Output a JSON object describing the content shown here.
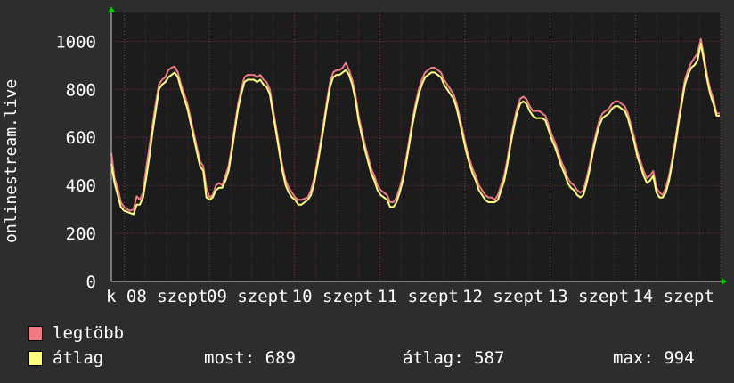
{
  "chart_data": {
    "type": "line",
    "ylabel": "onlinestream.live",
    "y_ticks": [
      0,
      200,
      400,
      600,
      800,
      1000
    ],
    "ylim": [
      0,
      1120
    ],
    "x_tick_labels": [
      "k 08 szept",
      "09 szept",
      "10 szept",
      "11 szept",
      "12 szept",
      "13 szept",
      "14 szept"
    ],
    "grid": true,
    "series": [
      {
        "name": "legtöbb",
        "color": "#f07a84",
        "values": [
          535,
          430,
          390,
          330,
          310,
          300,
          295,
          300,
          355,
          340,
          370,
          470,
          560,
          650,
          740,
          820,
          840,
          850,
          880,
          890,
          895,
          870,
          820,
          780,
          740,
          680,
          620,
          560,
          500,
          480,
          390,
          350,
          360,
          400,
          410,
          400,
          440,
          480,
          560,
          650,
          740,
          800,
          850,
          860,
          860,
          860,
          850,
          860,
          840,
          830,
          800,
          720,
          640,
          560,
          480,
          420,
          390,
          370,
          350,
          340,
          340,
          345,
          350,
          380,
          430,
          500,
          580,
          660,
          750,
          830,
          870,
          880,
          880,
          890,
          910,
          880,
          840,
          780,
          690,
          630,
          570,
          520,
          470,
          440,
          400,
          380,
          370,
          360,
          330,
          330,
          350,
          390,
          440,
          510,
          590,
          670,
          740,
          800,
          840,
          870,
          880,
          890,
          890,
          880,
          870,
          840,
          820,
          800,
          780,
          740,
          680,
          620,
          560,
          510,
          470,
          440,
          400,
          380,
          360,
          350,
          350,
          340,
          360,
          400,
          440,
          510,
          590,
          660,
          720,
          760,
          770,
          760,
          730,
          710,
          710,
          710,
          700,
          690,
          650,
          610,
          580,
          540,
          500,
          470,
          430,
          410,
          400,
          380,
          370,
          380,
          430,
          490,
          560,
          620,
          670,
          700,
          710,
          720,
          740,
          750,
          750,
          740,
          730,
          700,
          650,
          600,
          540,
          500,
          460,
          430,
          440,
          460,
          390,
          370,
          360,
          390,
          440,
          510,
          590,
          680,
          760,
          840,
          880,
          910,
          930,
          950,
          1010,
          940,
          860,
          800,
          760,
          700,
          700
        ]
      },
      {
        "name": "átlag",
        "color": "#ffff80",
        "values": [
          490,
          410,
          360,
          310,
          295,
          290,
          285,
          280,
          320,
          320,
          350,
          430,
          520,
          620,
          710,
          800,
          820,
          830,
          850,
          860,
          870,
          850,
          800,
          760,
          720,
          660,
          600,
          540,
          480,
          460,
          350,
          340,
          350,
          380,
          390,
          390,
          420,
          460,
          540,
          630,
          720,
          780,
          830,
          840,
          840,
          840,
          830,
          840,
          820,
          810,
          780,
          700,
          620,
          540,
          460,
          400,
          370,
          350,
          340,
          320,
          320,
          330,
          340,
          360,
          410,
          480,
          560,
          640,
          730,
          810,
          850,
          860,
          860,
          870,
          880,
          860,
          820,
          760,
          670,
          610,
          550,
          500,
          450,
          420,
          380,
          360,
          350,
          340,
          310,
          310,
          330,
          370,
          420,
          490,
          570,
          650,
          720,
          780,
          820,
          850,
          860,
          870,
          870,
          860,
          850,
          820,
          800,
          780,
          760,
          720,
          660,
          600,
          540,
          490,
          450,
          420,
          380,
          360,
          340,
          330,
          330,
          330,
          340,
          380,
          420,
          490,
          570,
          640,
          700,
          740,
          750,
          740,
          710,
          690,
          680,
          680,
          680,
          670,
          630,
          590,
          560,
          520,
          480,
          450,
          410,
          390,
          380,
          360,
          350,
          360,
          410,
          470,
          540,
          600,
          650,
          680,
          690,
          700,
          720,
          730,
          730,
          720,
          710,
          680,
          630,
          580,
          520,
          480,
          440,
          410,
          420,
          440,
          370,
          350,
          350,
          370,
          420,
          490,
          570,
          660,
          740,
          820,
          860,
          890,
          900,
          920,
          990,
          920,
          840,
          780,
          740,
          690,
          690
        ]
      }
    ]
  },
  "legend": [
    {
      "label": "legtöbb",
      "color": "#f07a84"
    },
    {
      "label": "átlag",
      "color": "#ffff80"
    }
  ],
  "stats": {
    "now": "most: 689",
    "avg": "átlag: 587",
    "max": "max: 994"
  }
}
